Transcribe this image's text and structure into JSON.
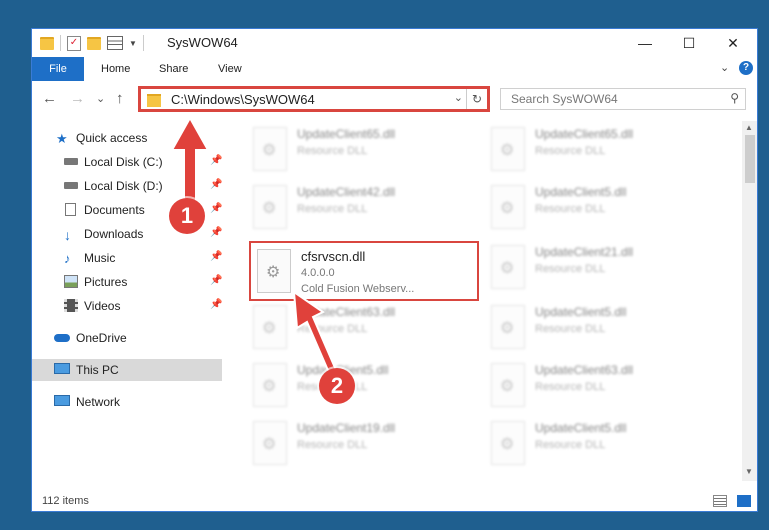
{
  "window": {
    "title": "SysWOW64",
    "controls": {
      "minimize": "—",
      "maximize": "☐",
      "close": "✕"
    }
  },
  "ribbon": {
    "tabs": [
      "File",
      "Home",
      "Share",
      "View"
    ],
    "expand": "⌄",
    "help": "?"
  },
  "nav": {
    "back": "←",
    "forward": "→",
    "recent": "⌄",
    "up": "↑",
    "address": "C:\\Windows\\SysWOW64",
    "address_dropdown": "⌄",
    "refresh": "↻",
    "search_placeholder": "Search SysWOW64",
    "search_icon": "⚲"
  },
  "sidebar": {
    "items": [
      {
        "label": "Quick access",
        "icon": "star-icon",
        "pinned": false
      },
      {
        "label": "Local Disk (C:)",
        "icon": "drive-icon",
        "pinned": true
      },
      {
        "label": "Local Disk (D:)",
        "icon": "drive-icon",
        "pinned": true
      },
      {
        "label": "Documents",
        "icon": "documents-icon",
        "pinned": true
      },
      {
        "label": "Downloads",
        "icon": "download-icon",
        "pinned": true
      },
      {
        "label": "Music",
        "icon": "music-icon",
        "pinned": true
      },
      {
        "label": "Pictures",
        "icon": "pictures-icon",
        "pinned": true
      },
      {
        "label": "Videos",
        "icon": "videos-icon",
        "pinned": true
      },
      {
        "label": "OneDrive",
        "icon": "cloud-icon",
        "pinned": false
      },
      {
        "label": "This PC",
        "icon": "computer-icon",
        "pinned": false,
        "selected": true
      },
      {
        "label": "Network",
        "icon": "network-icon",
        "pinned": false
      }
    ],
    "pin_glyph": "📌"
  },
  "files": {
    "left": [
      {
        "name": "UpdateClient65.dll",
        "type": "Resource DLL"
      },
      {
        "name": "UpdateClient42.dll",
        "type": "Resource DLL"
      },
      {
        "name": "cfsrvscn.dll",
        "type": "4.0.0.0",
        "desc": "Cold Fusion Webserv..."
      },
      {
        "name": "UpdateClient63.dll",
        "type": "Resource DLL"
      },
      {
        "name": "UpdateClient5.dll",
        "type": "Resource DLL"
      },
      {
        "name": "UpdateClient19.dll",
        "type": "Resource DLL"
      }
    ],
    "right": [
      {
        "name": "UpdateClient65.dll",
        "type": "Resource DLL"
      },
      {
        "name": "UpdateClient5.dll",
        "type": "Resource DLL"
      },
      {
        "name": "UpdateClient21.dll",
        "type": "Resource DLL"
      },
      {
        "name": "UpdateClient5.dll",
        "type": "Resource DLL"
      },
      {
        "name": "UpdateClient63.dll",
        "type": "Resource DLL"
      },
      {
        "name": "UpdateClient5.dll",
        "type": "Resource DLL"
      }
    ]
  },
  "status": {
    "count": "112 items"
  },
  "annotations": {
    "step1": "1",
    "step2": "2"
  },
  "colors": {
    "accent": "#1e6fc7",
    "highlight": "#d9463f",
    "badge": "#e0413b"
  }
}
